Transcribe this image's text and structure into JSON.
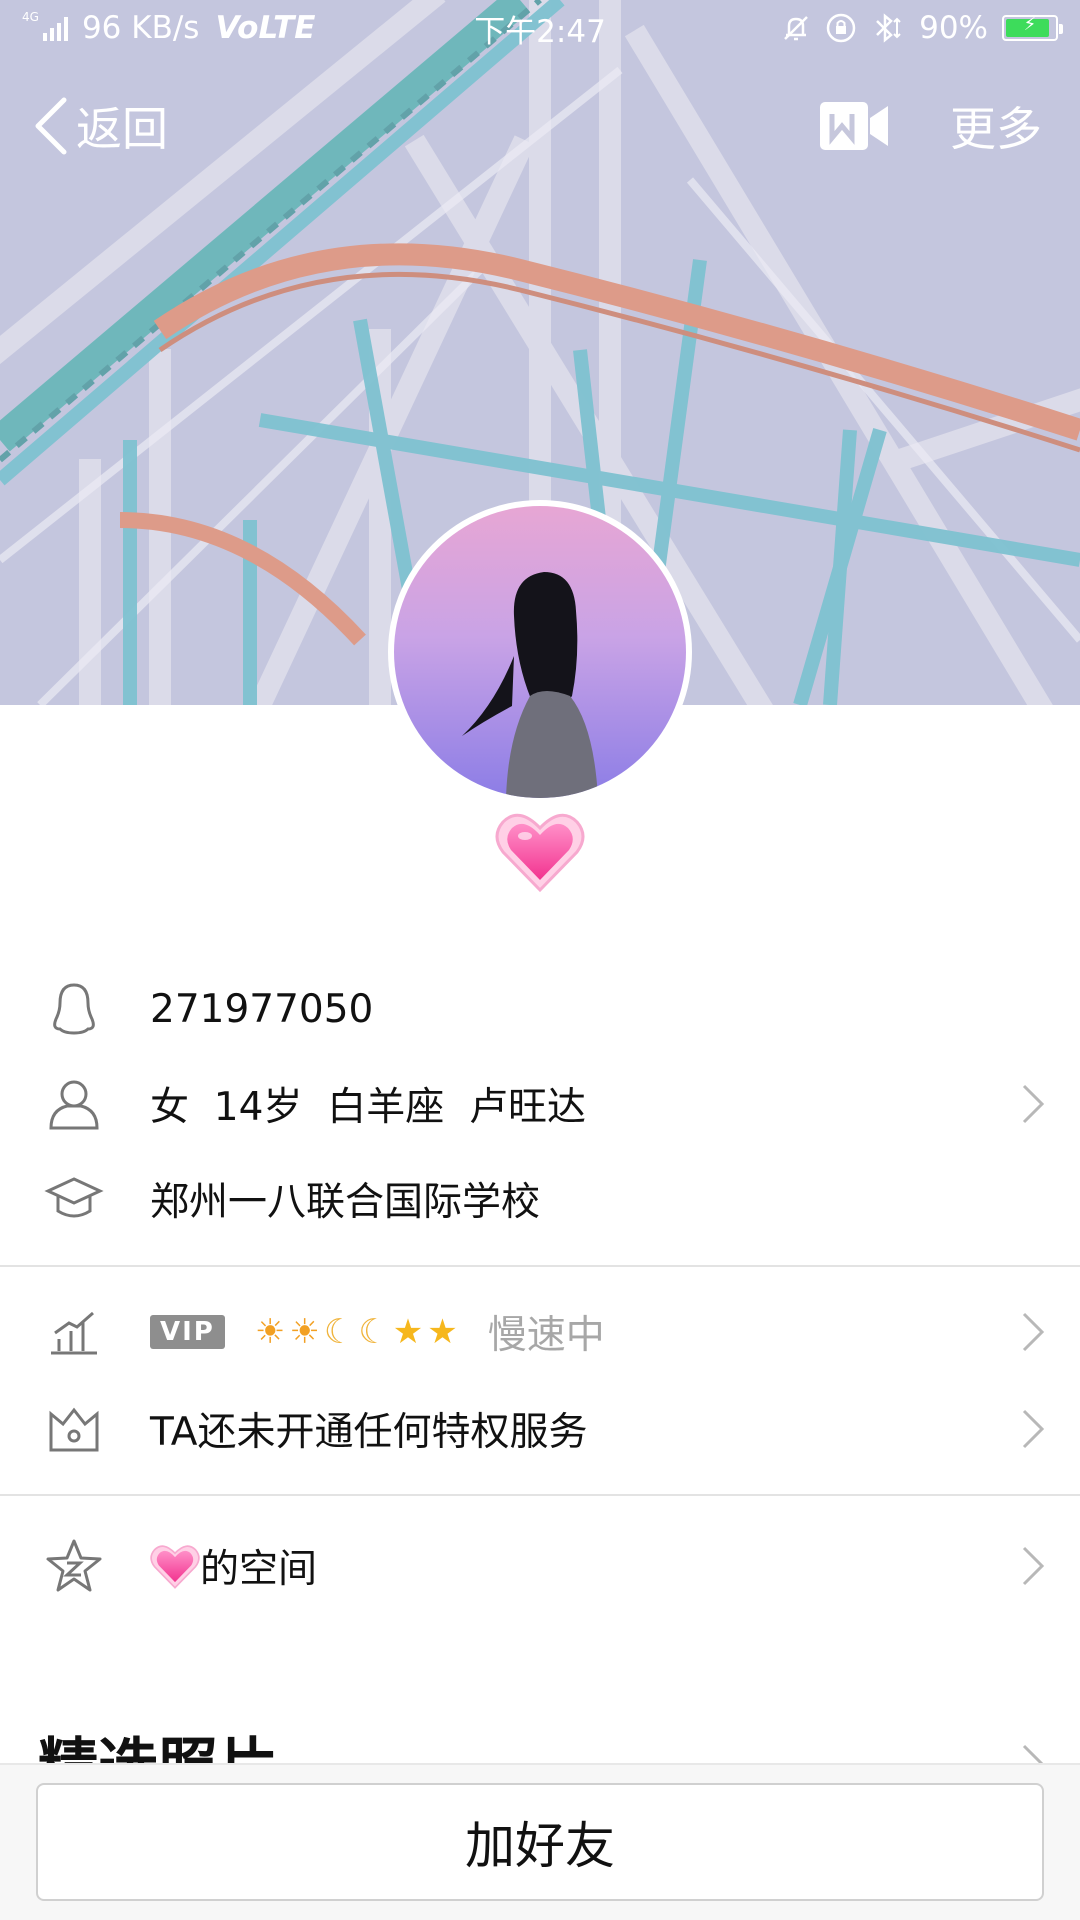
{
  "status_bar": {
    "network_tag": "4G",
    "speed": "96 KB/s",
    "volte": "VoLTE",
    "time": "下午2:47",
    "battery": "90%",
    "battery_level": 0.9
  },
  "nav": {
    "back_label": "返回",
    "more_label": "更多"
  },
  "profile": {
    "qq_number": "271977050",
    "basic_info": "女  14岁  白羊座  卢旺达",
    "school": "郑州一八联合国际学校",
    "vip_label": "VIP",
    "level_icons": [
      "☀",
      "☀",
      "☾",
      "☾",
      "★",
      "★"
    ],
    "level_status": "慢速中",
    "privilege_text": "TA还未开通任何特权服务",
    "space_emoji": "💗",
    "space_text": "的空间"
  },
  "sections": {
    "featured_photos": "精选照片"
  },
  "actions": {
    "add_friend": "加好友"
  },
  "colors": {
    "accent_heart": "#ff5fa8",
    "divider": "#e3e3e3",
    "vip_badge": "#8e8e8e",
    "muted_text": "#a7a7a7"
  },
  "icons": {
    "qq_row": "penguin-icon",
    "info_row": "person-icon",
    "school_row": "graduation-cap-icon",
    "level_row": "bar-chart-icon",
    "privilege_row": "crown-box-icon",
    "space_row": "star-z-icon",
    "video_call": "video-camera-icon",
    "back": "chevron-left-icon"
  }
}
